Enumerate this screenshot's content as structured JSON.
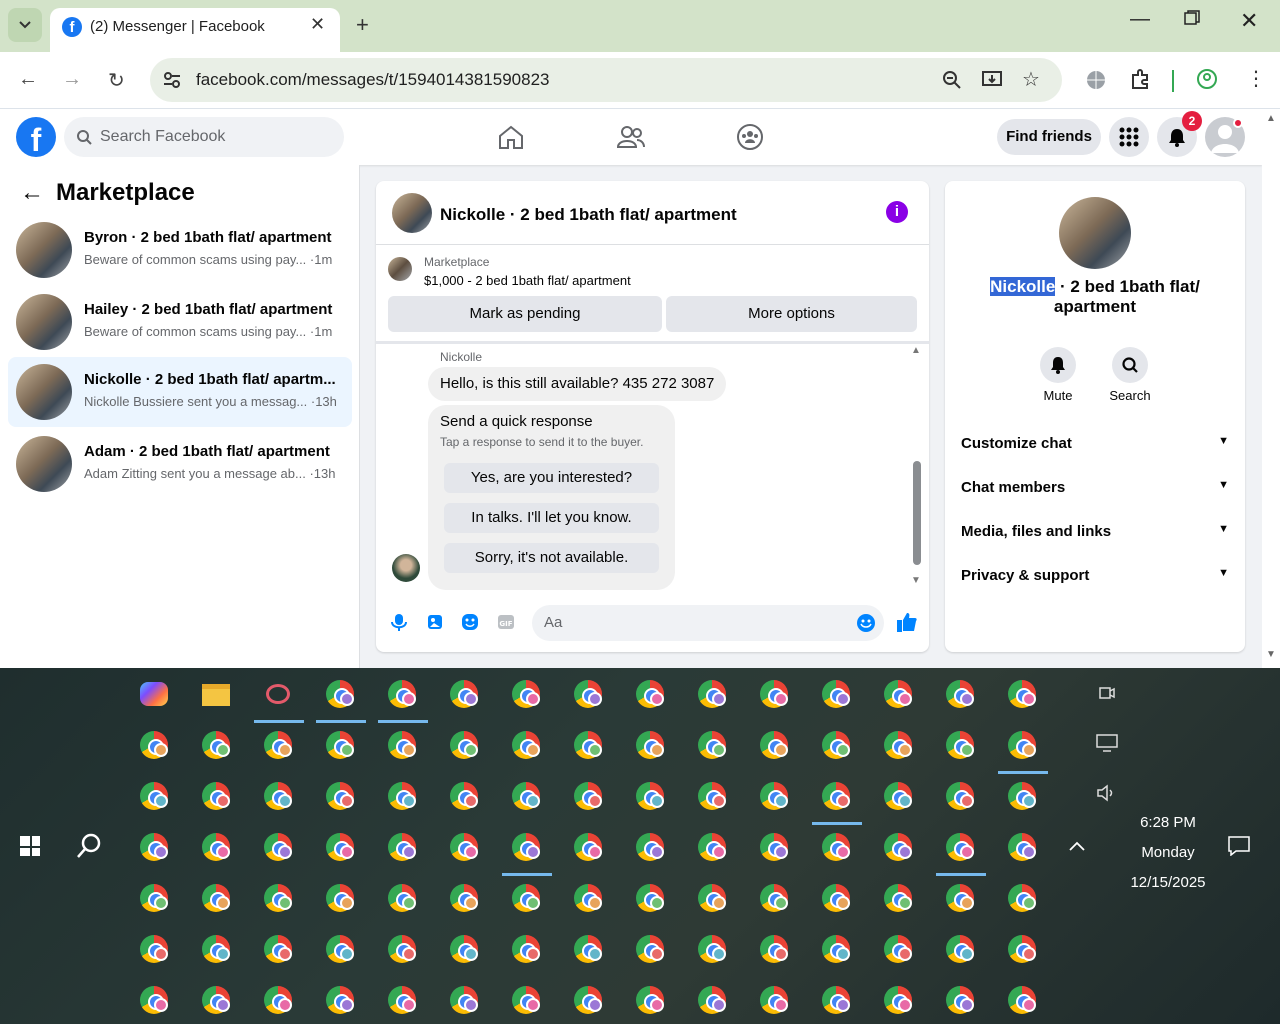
{
  "browser": {
    "tab_title": "(2) Messenger | Facebook",
    "tab_close": "✕",
    "new_tab": "+",
    "url": "facebook.com/messages/t/1594014381590823"
  },
  "facebook": {
    "search_placeholder": "Search Facebook",
    "find_friends": "Find friends",
    "notification_count": "2",
    "left_panel_title": "Marketplace",
    "conversations": [
      {
        "name": "Byron · 2 bed 1bath flat/ apartment",
        "preview": "Beware of common scams using pay... ·1m"
      },
      {
        "name": "Hailey · 2 bed 1bath flat/ apartment",
        "preview": "Beware of common scams using pay... ·1m"
      },
      {
        "name": "Nickolle · 2 bed 1bath flat/ apartm...",
        "preview": "Nickolle Bussiere sent you a messag... ·13h"
      },
      {
        "name": "Adam · 2 bed 1bath flat/ apartment",
        "preview": "Adam Zitting sent you a message ab... ·13h"
      }
    ],
    "chat": {
      "title": "Nickolle · 2 bed 1bath flat/ apartment",
      "listing_source": "Marketplace",
      "listing_price_title": "$1,000 - 2 bed 1bath flat/ apartment",
      "mark_pending": "Mark as pending",
      "more_options": "More options",
      "sender": "Nickolle",
      "message": "Hello, is this still available? 435 272 3087",
      "quick_title": "Send a quick response",
      "quick_sub": "Tap a response to send it to the buyer.",
      "quick_replies": [
        "Yes, are you interested?",
        "In talks. I'll let you know.",
        "Sorry, it's not available."
      ],
      "composer_placeholder": "Aa"
    },
    "details": {
      "name_highlight": "Nickolle",
      "name_rest": " · 2 bed 1bath flat/ apartment",
      "mute": "Mute",
      "search": "Search",
      "sections": [
        "Customize chat",
        "Chat members",
        "Media, files and links",
        "Privacy & support"
      ]
    }
  },
  "taskbar": {
    "time": "6:28 PM",
    "day": "Monday",
    "date": "12/15/2025"
  },
  "colors": {
    "fb_blue": "#1877f2",
    "messenger_purple": "#8a00e6",
    "badge_red": "#e41e3f"
  }
}
